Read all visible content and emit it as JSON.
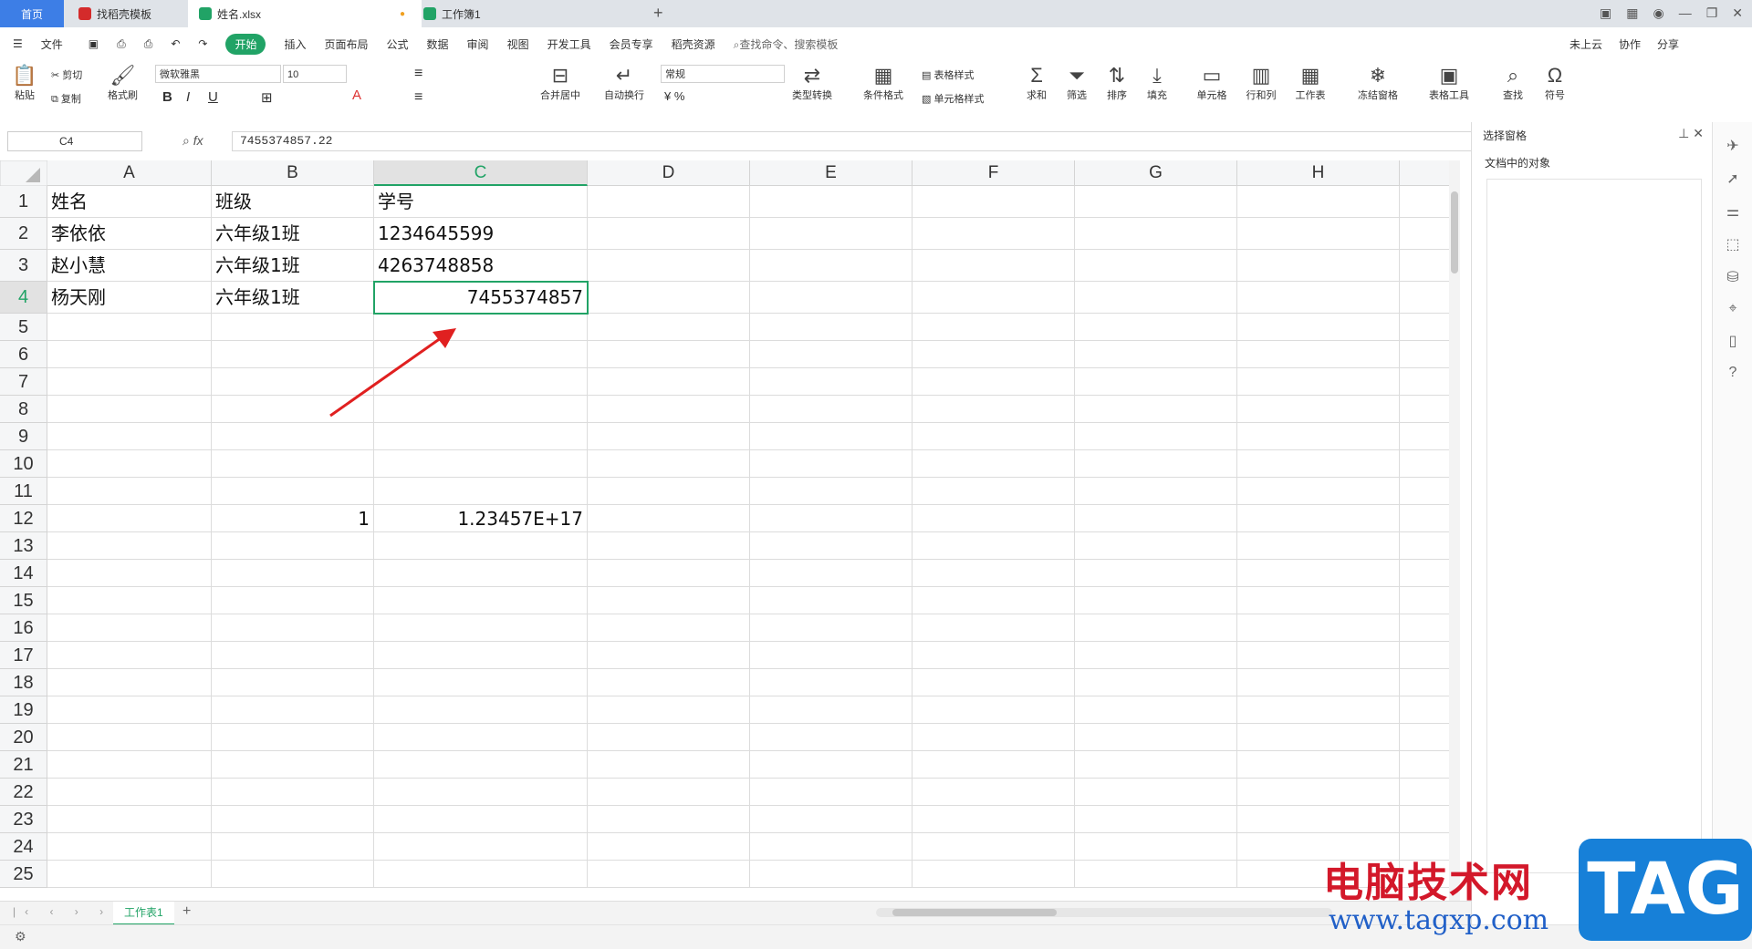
{
  "tabs": {
    "home": "首页",
    "t2": "找稻壳模板",
    "t3": "姓名.xlsx",
    "t4": "工作簿1"
  },
  "menu": [
    "文件",
    "开始",
    "插入",
    "页面布局",
    "公式",
    "数据",
    "审阅",
    "视图",
    "开发工具",
    "会员专享",
    "稻壳资源"
  ],
  "search_placeholder": "查找命令、搜索模板",
  "cloud": {
    "sync": "未上云",
    "collab": "协作",
    "share": "分享"
  },
  "toolbar": {
    "paste": "粘贴",
    "cut": "剪切",
    "copy": "复制",
    "format_painter": "格式刷",
    "font_name": "微软雅黑",
    "font_size": "10",
    "merge": "合并居中",
    "wrap": "自动换行",
    "number_format": "常规",
    "type_convert": "类型转换",
    "cond_format": "条件格式",
    "table_style": "表格样式",
    "cell_style": "单元格样式",
    "sum": "求和",
    "filter": "筛选",
    "sort": "排序",
    "fill": "填充",
    "cell": "单元格",
    "rowcol": "行和列",
    "sheet": "工作表",
    "freeze": "冻结窗格",
    "table_tools": "表格工具",
    "find": "查找",
    "symbol": "符号"
  },
  "formula": {
    "name_box": "C4",
    "fx": "fx",
    "value": "7455374857.22"
  },
  "columns": [
    "A",
    "B",
    "C",
    "D",
    "E",
    "F",
    "G",
    "H"
  ],
  "rows": [
    "1",
    "2",
    "3",
    "4",
    "5",
    "6",
    "7",
    "8",
    "9",
    "10",
    "11",
    "12",
    "13",
    "14",
    "15",
    "16",
    "17",
    "18",
    "19",
    "20",
    "21",
    "22",
    "23",
    "24",
    "25"
  ],
  "cells": {
    "A1": "姓名",
    "B1": "班级",
    "C1": "学号",
    "A2": "李依依",
    "B2": "六年级1班",
    "C2": "1234645599",
    "A3": "赵小慧",
    "B3": "六年级1班",
    "C3": "4263748858",
    "A4": "杨天刚",
    "B4": "六年级1班",
    "C4": "7455374857",
    "B12": "1",
    "C12": "1.23457E+17"
  },
  "sheet_tab": "工作表1",
  "right_panel": {
    "title": "选择窗格",
    "objects_label": "文档中的对象"
  },
  "watermark": {
    "cn": "电脑技术网",
    "url": "www.tagxp.com",
    "tag": "TAG"
  },
  "colors": {
    "accent": "#21a366",
    "tab_home": "#3d7ee6",
    "arrow": "#e02020"
  }
}
